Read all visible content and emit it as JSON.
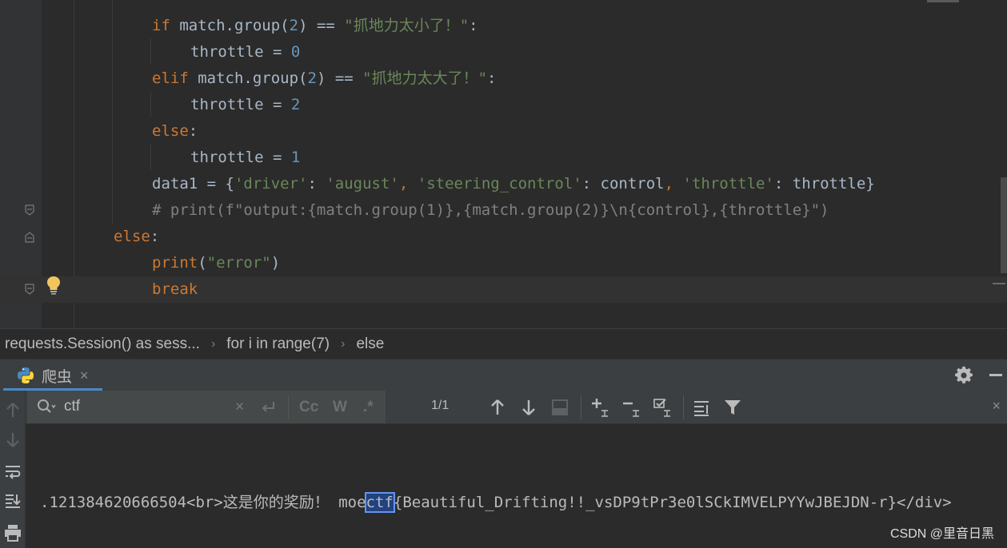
{
  "editor": {
    "lines": [
      {
        "tokens": [
          {
            "t": "if",
            "c": "kw"
          },
          {
            "t": " match.group(",
            "c": ""
          },
          {
            "t": "2",
            "c": "num"
          },
          {
            "t": ") == ",
            "c": ""
          },
          {
            "t": "\"抓地力太小了！\"",
            "c": "str"
          },
          {
            "t": ":",
            "c": ""
          }
        ]
      },
      {
        "tokens": [
          {
            "t": "throttle = ",
            "c": ""
          },
          {
            "t": "0",
            "c": "num"
          }
        ]
      },
      {
        "tokens": [
          {
            "t": "elif",
            "c": "kw"
          },
          {
            "t": " match.group(",
            "c": ""
          },
          {
            "t": "2",
            "c": "num"
          },
          {
            "t": ") == ",
            "c": ""
          },
          {
            "t": "\"抓地力太大了！\"",
            "c": "str"
          },
          {
            "t": ":",
            "c": ""
          }
        ]
      },
      {
        "tokens": [
          {
            "t": "throttle = ",
            "c": ""
          },
          {
            "t": "2",
            "c": "num"
          }
        ]
      },
      {
        "tokens": [
          {
            "t": "else",
            "c": "kw"
          },
          {
            "t": ":",
            "c": ""
          }
        ]
      },
      {
        "tokens": [
          {
            "t": "throttle = ",
            "c": ""
          },
          {
            "t": "1",
            "c": "num"
          }
        ]
      },
      {
        "tokens": [
          {
            "t": "data1 = {",
            "c": ""
          },
          {
            "t": "'driver'",
            "c": "str"
          },
          {
            "t": ": ",
            "c": ""
          },
          {
            "t": "'august'",
            "c": "str"
          },
          {
            "t": ", ",
            "c": "kw"
          },
          {
            "t": "'steering_control'",
            "c": "str"
          },
          {
            "t": ": control",
            "c": ""
          },
          {
            "t": ", ",
            "c": "kw"
          },
          {
            "t": "'throttle'",
            "c": "str"
          },
          {
            "t": ": throttle}",
            "c": ""
          }
        ]
      },
      {
        "tokens": [
          {
            "t": "# print(f\"output:{match.group(1)},{match.group(2)}\\n{control},{throttle}\")",
            "c": "cmt"
          }
        ]
      },
      {
        "tokens": [
          {
            "t": "else",
            "c": "kw"
          },
          {
            "t": ":",
            "c": ""
          }
        ]
      },
      {
        "tokens": [
          {
            "t": "print",
            "c": "kw"
          },
          {
            "t": "(",
            "c": ""
          },
          {
            "t": "\"error\"",
            "c": "str"
          },
          {
            "t": ")",
            "c": ""
          }
        ]
      },
      {
        "tokens": [
          {
            "t": "break",
            "c": "kw"
          }
        ]
      }
    ]
  },
  "breadcrumb": {
    "items": [
      "requests.Session() as sess...",
      "for i in range(7)",
      "else"
    ],
    "separator": "›"
  },
  "run_panel": {
    "tab_label": "爬虫",
    "tab_close": "×"
  },
  "search": {
    "value": "ctf",
    "clear": "×",
    "regex_glyph": ".*",
    "match_case_glyph": "Cc",
    "words_glyph": "W",
    "match_count": "1/1",
    "close": "×"
  },
  "console": {
    "before": ".121384620666504<br>这是你的奖励！ moe",
    "hit": "ctf",
    "after": "{Beautiful_Drifting!!_vsDP9tPr3e0lSCkIMVELPYYwJBEJDN-r}</div>"
  },
  "watermark": "CSDN @里音日黑",
  "colors": {
    "keyword": "#cc7832",
    "string": "#6a8759",
    "number": "#6897bb",
    "comment": "#808080",
    "selection": "#214283"
  }
}
